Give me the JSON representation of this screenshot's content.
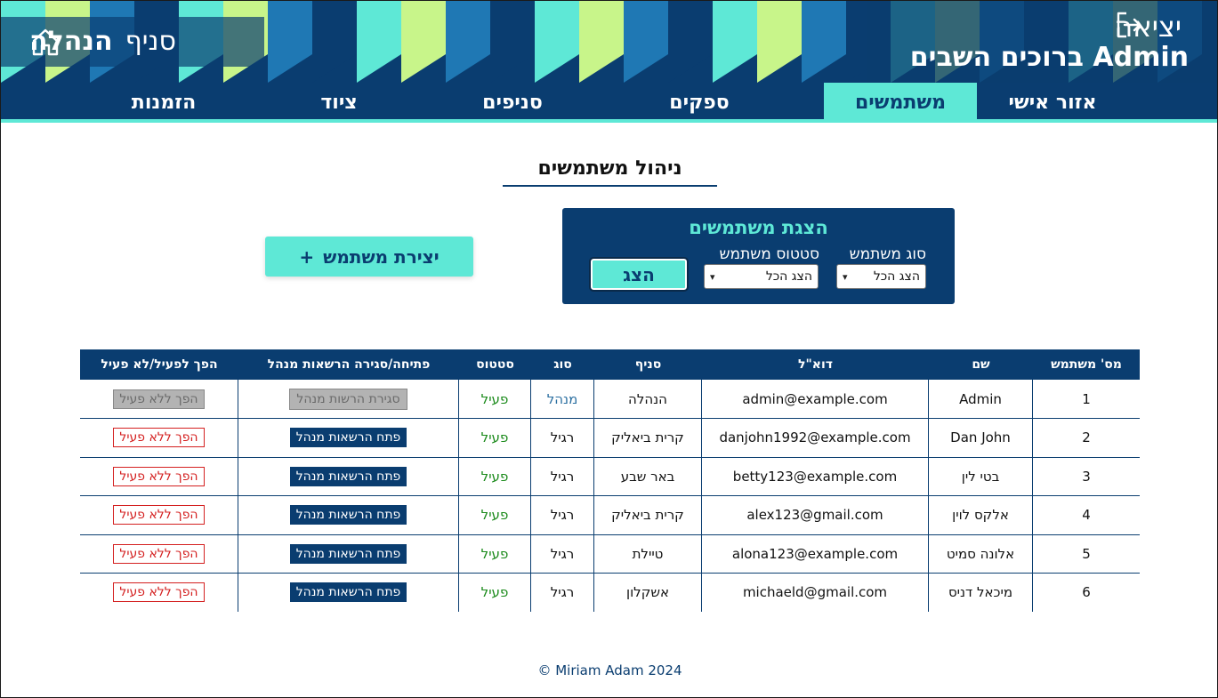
{
  "header": {
    "logout_label": "יציאה",
    "brand_title": "Admin ברוכים השבים",
    "branch_label": "סניף",
    "branch_name": "הנהלה"
  },
  "nav": {
    "items": [
      {
        "label": "אזור אישי"
      },
      {
        "label": "משתמשים",
        "active": true
      },
      {
        "label": "ספקים"
      },
      {
        "label": "סניפים"
      },
      {
        "label": "ציוד"
      },
      {
        "label": "הזמנות"
      }
    ]
  },
  "page": {
    "title": "ניהול משתמשים"
  },
  "filter": {
    "title": "הצגת משתמשים",
    "type_label": "סוג משתמש",
    "type_value": "הצג הכל",
    "status_label": "סטטוס משתמש",
    "status_value": "הצג הכל",
    "show_label": "הצג"
  },
  "create": {
    "label": "יצירת משתמש",
    "plus": "+"
  },
  "table": {
    "headers": [
      "מס' משתמש",
      "שם",
      "דוא\"ל",
      "סניף",
      "סוג",
      "סטטוס",
      "פתיחה/סגירה הרשאות מנהל",
      "הפך לפעיל/לא פעיל"
    ],
    "rows": [
      {
        "id": "1",
        "name": "Admin",
        "email": "admin@example.com",
        "branch": "הנהלה",
        "type": "מנהל",
        "status": "פעיל",
        "admin_action": "סגירת הרשות מנהל",
        "toggle": "הפך ללא פעיל"
      },
      {
        "id": "2",
        "name": "Dan John",
        "email": "danjohn1992@example.com",
        "branch": "קרית ביאליק",
        "type": "רגיל",
        "status": "פעיל",
        "admin_action": "פתח הרשאות מנהל",
        "toggle": "הפך ללא פעיל"
      },
      {
        "id": "3",
        "name": "בטי לין",
        "email": "betty123@example.com",
        "branch": "באר שבע",
        "type": "רגיל",
        "status": "פעיל",
        "admin_action": "פתח הרשאות מנהל",
        "toggle": "הפך ללא פעיל"
      },
      {
        "id": "4",
        "name": "אלקס לוין",
        "email": "alex123@gmail.com",
        "branch": "קרית ביאליק",
        "type": "רגיל",
        "status": "פעיל",
        "admin_action": "פתח הרשאות מנהל",
        "toggle": "הפך ללא פעיל"
      },
      {
        "id": "5",
        "name": "אלונה סמיט",
        "email": "alona123@example.com",
        "branch": "טיילת",
        "type": "רגיל",
        "status": "פעיל",
        "admin_action": "פתח הרשאות מנהל",
        "toggle": "הפך ללא פעיל"
      },
      {
        "id": "6",
        "name": "מיכאל דניס",
        "email": "michaeld@gmail.com",
        "branch": "אשקלון",
        "type": "רגיל",
        "status": "פעיל",
        "admin_action": "פתח הרשאות מנהל",
        "toggle": "הפך ללא פעיל"
      }
    ]
  },
  "footer": {
    "text": "© Miriam Adam 2024"
  },
  "colors": {
    "navy": "#0a3d70",
    "aqua": "#5ee8d6",
    "lime": "#c8f58a",
    "blue": "#1f78b4",
    "status_green": "#1a8a1a",
    "toggle_red": "#d42020"
  },
  "icons": {
    "logout": "logout-icon",
    "home": "home-icon",
    "chevron": "chevron-down-icon"
  }
}
